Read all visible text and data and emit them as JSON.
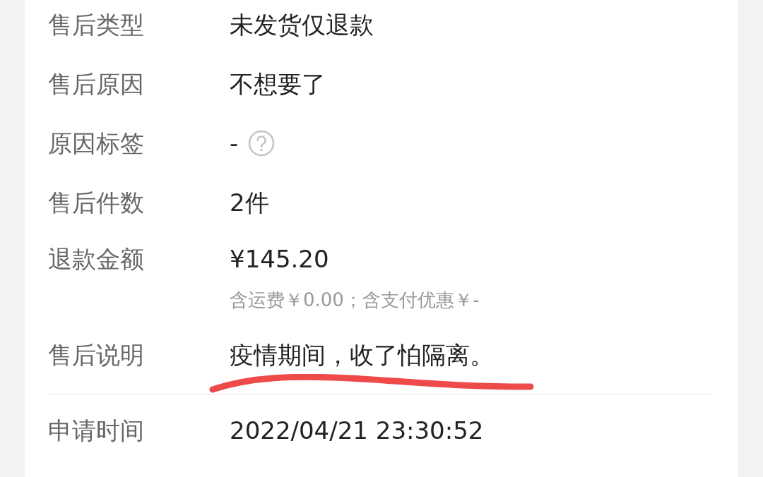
{
  "sections": [
    {
      "rows": [
        {
          "kind": "text",
          "label": "售后类型",
          "value": "未发货仅退款"
        },
        {
          "kind": "text",
          "label": "售后原因",
          "value": "不想要了"
        },
        {
          "kind": "help",
          "label": "原因标签",
          "value": "-"
        },
        {
          "kind": "text",
          "label": "售后件数",
          "value": "2件"
        },
        {
          "kind": "amount",
          "label": "退款金额",
          "value": "¥145.20",
          "note": "含运费￥0.00；含支付优惠￥-"
        },
        {
          "kind": "text",
          "label": "售后说明",
          "value": "疫情期间，收了怕隔离。",
          "underlined": true
        }
      ]
    },
    {
      "rows": [
        {
          "kind": "text",
          "label": "申请时间",
          "value": "2022/04/21 23:30:52"
        }
      ]
    }
  ]
}
